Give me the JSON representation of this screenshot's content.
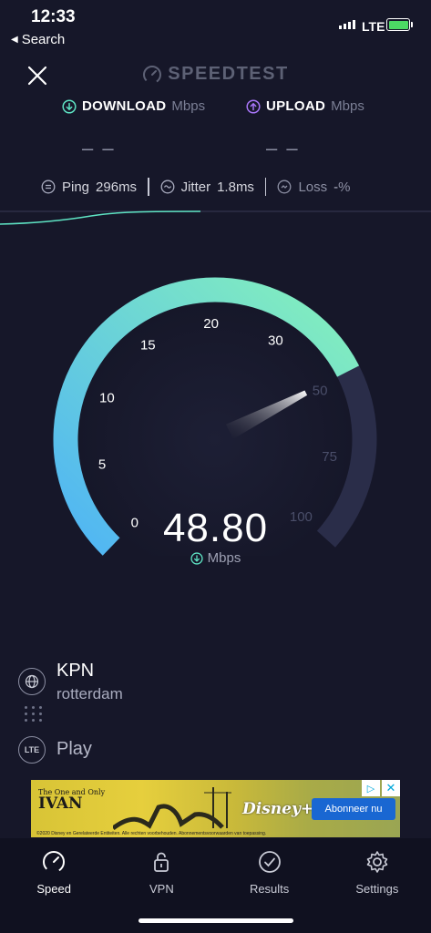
{
  "status_bar": {
    "time": "12:33",
    "back_label": "Search",
    "network": "LTE",
    "battery_level": 1.0
  },
  "header": {
    "brand": "SPEEDTEST"
  },
  "metrics": {
    "download_label": "DOWNLOAD",
    "download_unit": "Mbps",
    "download_value": "– –",
    "upload_label": "UPLOAD",
    "upload_unit": "Mbps",
    "upload_value": "– –"
  },
  "stats": {
    "ping_label": "Ping",
    "ping_value": "296",
    "ping_unit": "ms",
    "jitter_label": "Jitter",
    "jitter_value": "1.8",
    "jitter_unit": "ms",
    "loss_label": "Loss",
    "loss_value": "-",
    "loss_unit": "%"
  },
  "gauge": {
    "ticks": [
      "0",
      "5",
      "10",
      "15",
      "20",
      "30",
      "50",
      "75",
      "100"
    ],
    "current_value": 48.8,
    "speed_text": "48.80",
    "unit": "Mbps"
  },
  "provider": {
    "name": "KPN",
    "location": "rotterdam",
    "server_badge": "LTE",
    "server_name": "Play"
  },
  "ad": {
    "title_small": "The One and Only",
    "title_big": "IVAN",
    "brand": "Disney+",
    "cta": "Abonneer nu",
    "legal": "©2020 Disney en Gerelateerde Entiteiten. Alle rechten voorbehouden. Abonnementsvoorwaarden van toepassing."
  },
  "tabs": [
    {
      "label": "Speed",
      "icon": "gauge-icon",
      "active": true
    },
    {
      "label": "VPN",
      "icon": "lock-icon",
      "active": false
    },
    {
      "label": "Results",
      "icon": "check-circle-icon",
      "active": false
    },
    {
      "label": "Settings",
      "icon": "gear-icon",
      "active": false
    }
  ],
  "colors": {
    "background": "#161729",
    "gauge_start": "#4fb4f5",
    "gauge_end": "#85f1bb",
    "download_icon": "#5ee3c3",
    "upload_icon": "#a775f7"
  }
}
